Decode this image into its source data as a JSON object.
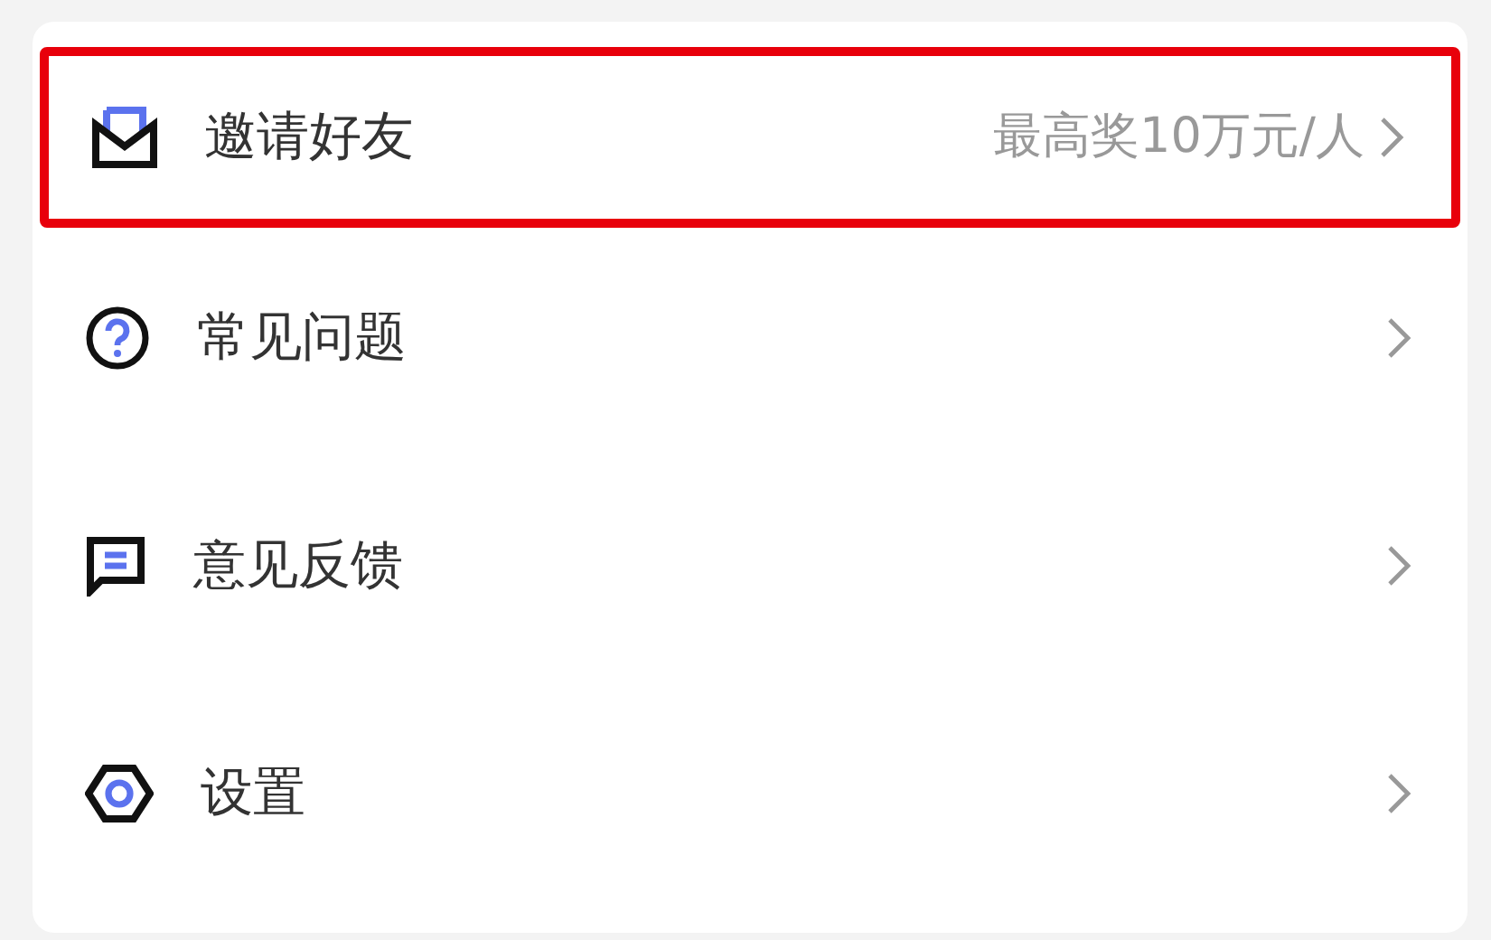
{
  "menu": [
    {
      "label": "邀请好友",
      "note": "最高奖10万元/人",
      "highlighted": true
    },
    {
      "label": "常见问题",
      "highlighted": false
    },
    {
      "label": "意见反馈",
      "highlighted": false
    },
    {
      "label": "设置",
      "highlighted": false
    }
  ]
}
